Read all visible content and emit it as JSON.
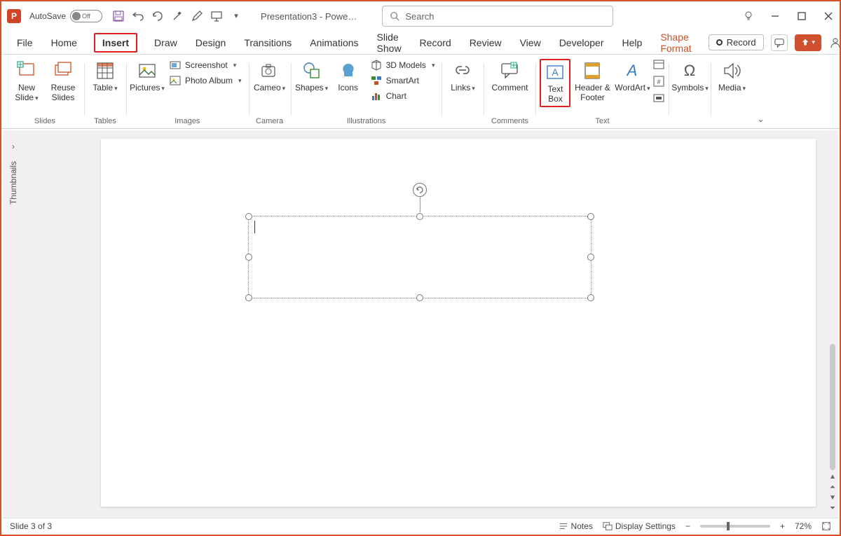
{
  "titlebar": {
    "autosave_label": "AutoSave",
    "autosave_state": "Off",
    "doc_title": "Presentation3 - Powe…",
    "search_placeholder": "Search"
  },
  "tabs": {
    "file": "File",
    "home": "Home",
    "insert": "Insert",
    "draw": "Draw",
    "design": "Design",
    "transitions": "Transitions",
    "animations": "Animations",
    "slideshow": "Slide Show",
    "record": "Record",
    "review": "Review",
    "view": "View",
    "developer": "Developer",
    "help": "Help",
    "shapeformat": "Shape Format",
    "record_btn": "Record"
  },
  "ribbon": {
    "slides": {
      "label": "Slides",
      "new_slide": "New Slide",
      "reuse": "Reuse Slides"
    },
    "tables": {
      "label": "Tables",
      "table": "Table"
    },
    "images": {
      "label": "Images",
      "pictures": "Pictures",
      "screenshot": "Screenshot",
      "photo_album": "Photo Album"
    },
    "camera": {
      "label": "Camera",
      "cameo": "Cameo"
    },
    "illustrations": {
      "label": "Illustrations",
      "shapes": "Shapes",
      "icons": "Icons",
      "models": "3D Models",
      "smartart": "SmartArt",
      "chart": "Chart"
    },
    "links": {
      "label": "",
      "links": "Links"
    },
    "comments": {
      "label": "Comments",
      "comment": "Comment"
    },
    "text": {
      "label": "Text",
      "textbox": "Text Box",
      "header": "Header & Footer",
      "wordart": "WordArt"
    },
    "symbols": {
      "label": "",
      "symbols": "Symbols"
    },
    "media": {
      "label": "",
      "media": "Media"
    }
  },
  "thumbnails_label": "Thumbnails",
  "status": {
    "slide": "Slide 3 of 3",
    "notes": "Notes",
    "display": "Display Settings",
    "zoom": "72%"
  }
}
